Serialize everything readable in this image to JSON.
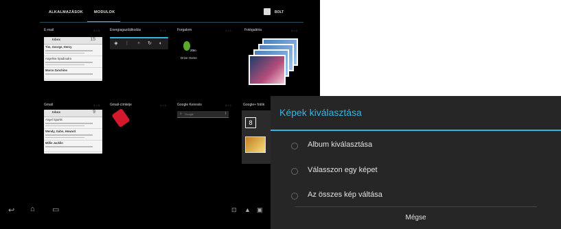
{
  "tabs": [
    {
      "label": "ALKALMAZÁSOK"
    },
    {
      "label": "MODULOK"
    }
  ],
  "store_label": "BOLT",
  "widgets": {
    "email": {
      "title": "E-mail",
      "size": "3 × 3"
    },
    "power": {
      "title": "Energiagazdálkodás",
      "size": "3 × 1"
    },
    "traffic": {
      "title": "Forgalom",
      "size": "1 × 1",
      "time": "20m",
      "label": "Drive Home"
    },
    "gallery": {
      "title": "Fotógaléria",
      "size": "2 × 2"
    },
    "gmail": {
      "title": "Gmail",
      "size": "3 × 3"
    },
    "gmail_labels": {
      "title": "Gmail-címkéje",
      "size": "1 × 1"
    },
    "google_search": {
      "title": "Google Keresés",
      "size": "4 × 1",
      "placeholder": "Google"
    },
    "gplus_photos": {
      "title": "Google+ fotók"
    }
  },
  "email_card": {
    "header": "Inbox",
    "count": "15",
    "rows": [
      "Tim, George, Henry",
      "Angelina Spadoudra",
      "Marco Zanchino"
    ]
  },
  "gmail_card": {
    "header": "Inbox",
    "count": "9",
    "rows": [
      "Angel Sparks",
      "Wendy, Gabo, Howard",
      "Millie Jacklin"
    ]
  },
  "dialog": {
    "title": "Képek kiválasztása",
    "options": [
      {
        "label": "Album kiválasztása"
      },
      {
        "label": "Válasszon egy képet"
      },
      {
        "label": "Az összes kép váltása"
      }
    ],
    "cancel": "Mégse"
  },
  "colors": {
    "accent": "#33b5e5",
    "background": "#000000",
    "dialog": "#262626"
  }
}
